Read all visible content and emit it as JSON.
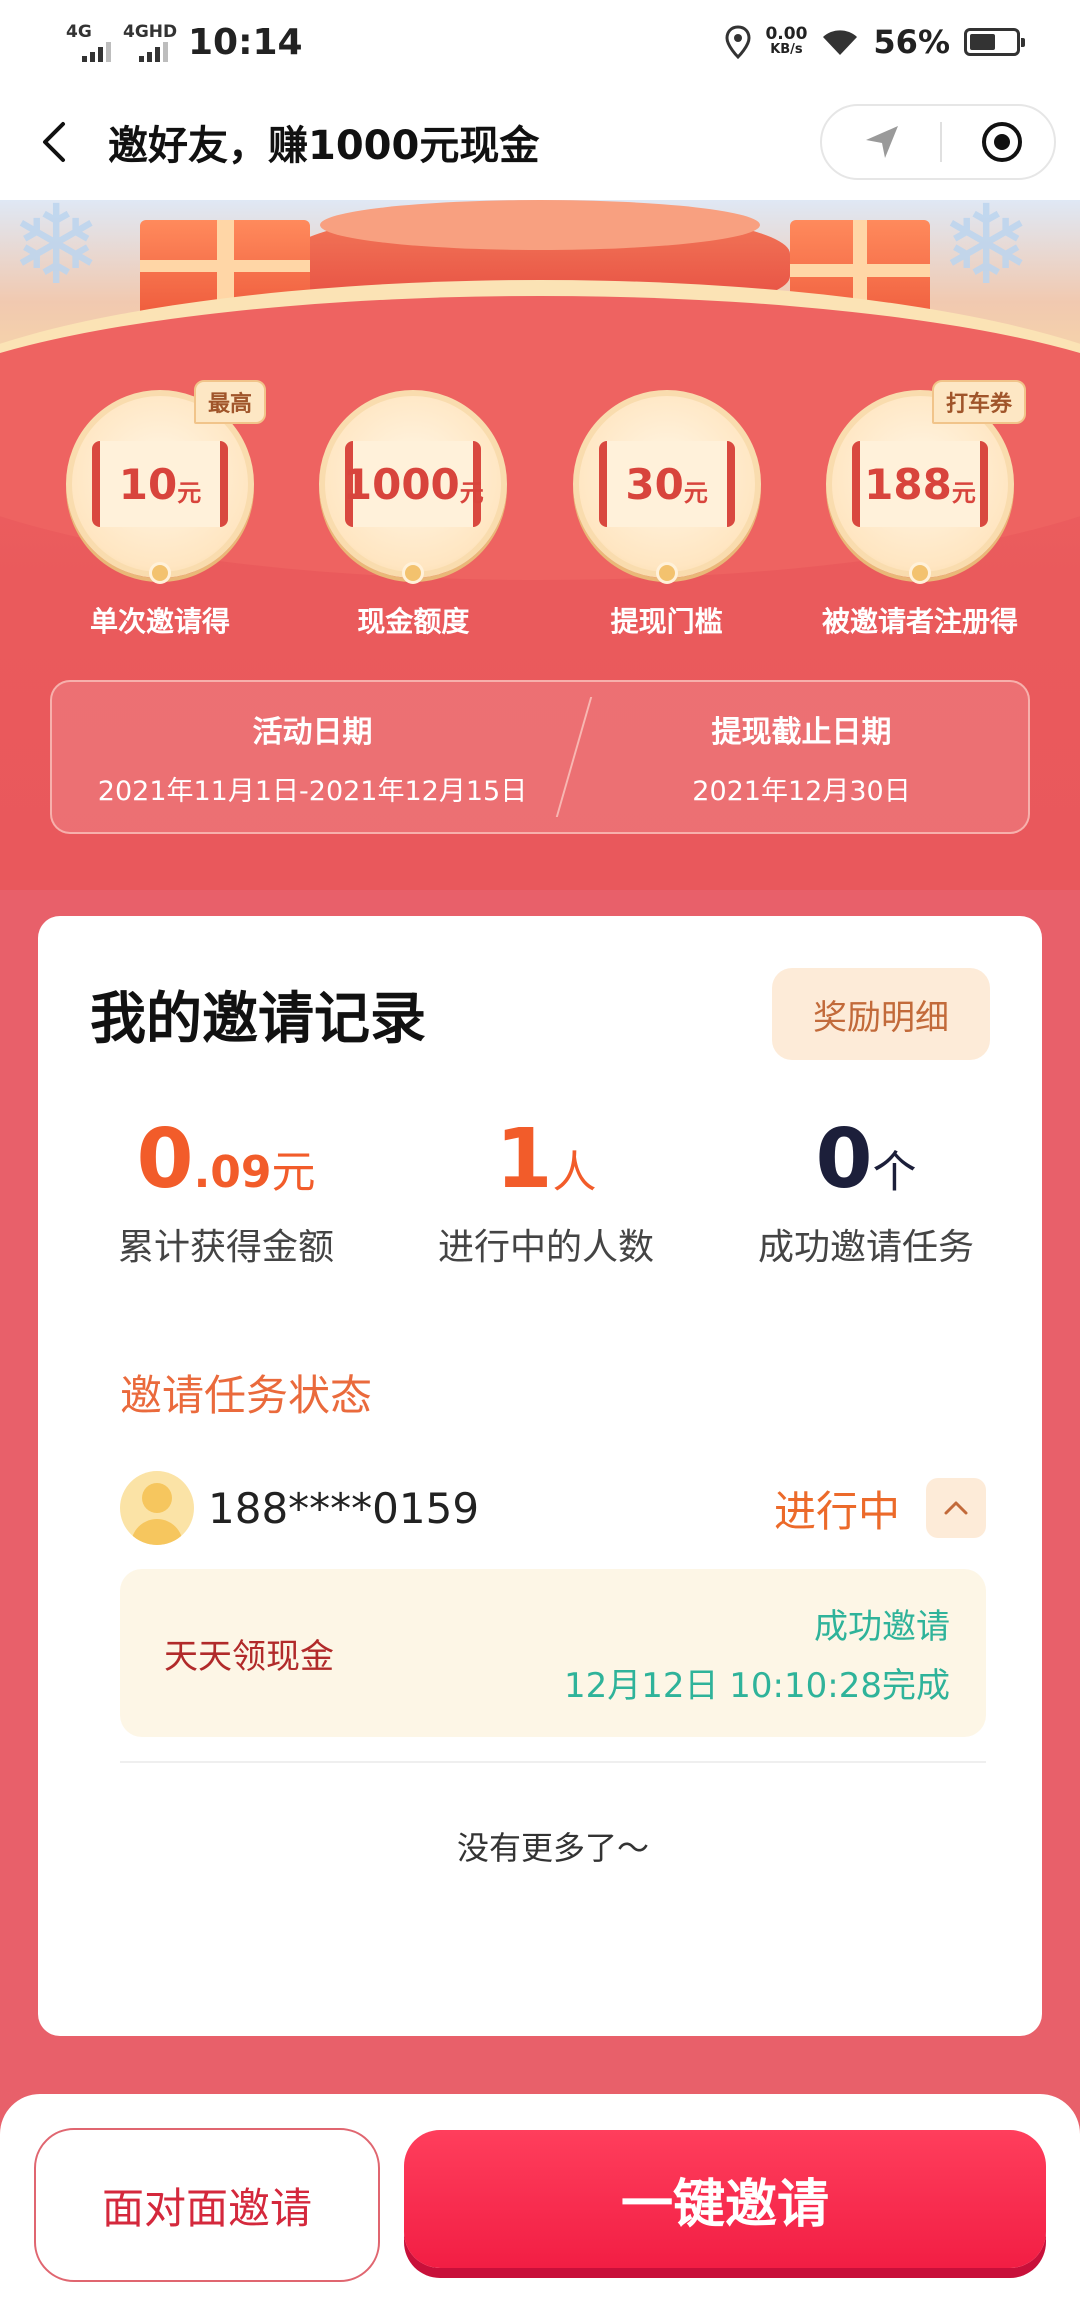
{
  "status_bar": {
    "sim1": "4G",
    "sim2": "4GHD",
    "time": "10:14",
    "net_speed_value": "0.00",
    "net_speed_unit": "KB/s",
    "battery": "56%",
    "battery_level": 0.56
  },
  "nav": {
    "title": "邀好友，赚1000元现金"
  },
  "rewards": [
    {
      "value": "10",
      "unit": "元",
      "label": "单次邀请得",
      "tag": "最高"
    },
    {
      "value": "1000",
      "unit": "元",
      "label": "现金额度",
      "tag": ""
    },
    {
      "value": "30",
      "unit": "元",
      "label": "提现门槛",
      "tag": ""
    },
    {
      "value": "188",
      "unit": "元",
      "label": "被邀请者注册得",
      "tag": "打车券"
    }
  ],
  "dates": {
    "activity_title": "活动日期",
    "activity_value": "2021年11月1日-2021年12月15日",
    "deadline_title": "提现截止日期",
    "deadline_value": "2021年12月30日"
  },
  "records": {
    "title": "我的邀请记录",
    "detail_button": "奖励明细",
    "stats": [
      {
        "big": "0",
        "small": ".09",
        "unit": "元",
        "label": "累计获得金额"
      },
      {
        "big": "1",
        "small": "",
        "unit": "人",
        "label": "进行中的人数"
      },
      {
        "big": "0",
        "small": "",
        "unit": "个",
        "label": "成功邀请任务"
      }
    ],
    "section_title": "邀请任务状态",
    "task": {
      "phone": "188****0159",
      "status": "进行中",
      "name": "天天领现金",
      "result": "成功邀请",
      "time": "12月12日 10:10:28完成"
    },
    "no_more": "没有更多了～"
  },
  "bottom": {
    "face_to_face": "面对面邀请",
    "one_click": "一键邀请"
  },
  "colors": {
    "primary_red": "#f21e44",
    "banner_red": "#ea5a5c",
    "orange": "#f25c2a",
    "green": "#2fb39a"
  }
}
